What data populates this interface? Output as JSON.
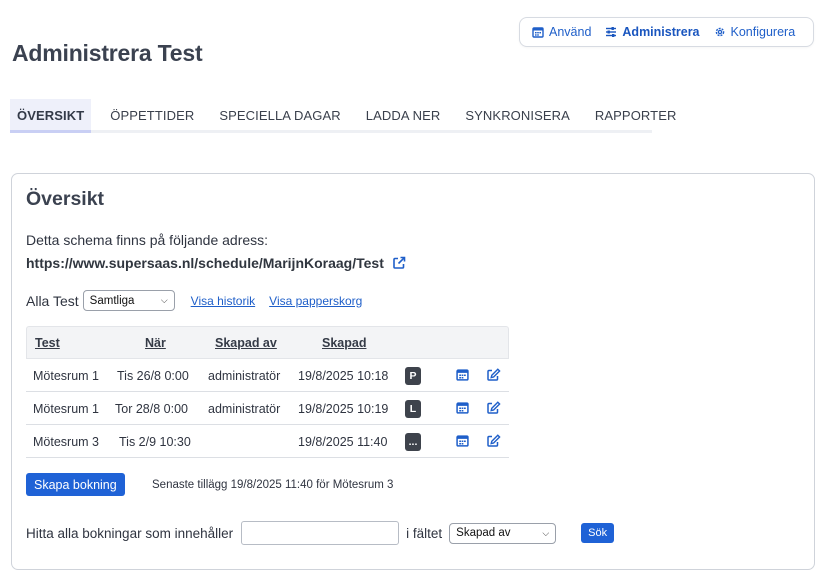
{
  "top_nav": {
    "items": [
      {
        "label": "Använd",
        "icon": "calendar-icon"
      },
      {
        "label": "Administrera",
        "icon": "sliders-icon",
        "active": true
      },
      {
        "label": "Konfigurera",
        "icon": "gear-icon"
      }
    ]
  },
  "page_title": "Administrera Test",
  "tabs": [
    {
      "label": "ÖVERSIKT",
      "active": true
    },
    {
      "label": "ÖPPETTIDER"
    },
    {
      "label": "SPECIELLA DAGAR"
    },
    {
      "label": "LADDA NER"
    },
    {
      "label": "SYNKRONISERA"
    },
    {
      "label": "RAPPORTER"
    }
  ],
  "overview": {
    "title": "Översikt",
    "address_text": "Detta schema finns på följande adress:",
    "address_url": "https://www.supersaas.nl/schedule/MarijnKoraag/Test",
    "filter": {
      "label": "Alla Test",
      "selected": "Samtliga",
      "links": [
        "Visa historik",
        "Visa papperskorg"
      ]
    },
    "table": {
      "headers": [
        "Test",
        "När",
        "Skapad av",
        "Skapad"
      ],
      "rows": [
        {
          "test": "Mötesrum 1",
          "when": "Tis 26/8 0:00",
          "created_by": "administratör",
          "created": "19/8/2025 10:18",
          "badge": "P"
        },
        {
          "test": "Mötesrum 1",
          "when": "Tor 28/8 0:00",
          "created_by": "administratör",
          "created": "19/8/2025 10:19",
          "badge": "L"
        },
        {
          "test": "Mötesrum 3",
          "when": "Tis 2/9 10:30",
          "created_by": "",
          "created": "19/8/2025 11:40",
          "badge": "..."
        }
      ]
    },
    "create_button": "Skapa bokning",
    "last_added": "Senaste tillägg 19/8/2025 11:40 för Mötesrum 3",
    "search": {
      "label": "Hitta alla bokningar som innehåller",
      "value": "",
      "field_label": "i fältet",
      "field_selected": "Skapad av",
      "button": "Sök"
    }
  },
  "colors": {
    "accent": "#1f62d6",
    "link": "#1f5fc9",
    "badge": "#3e434c"
  }
}
